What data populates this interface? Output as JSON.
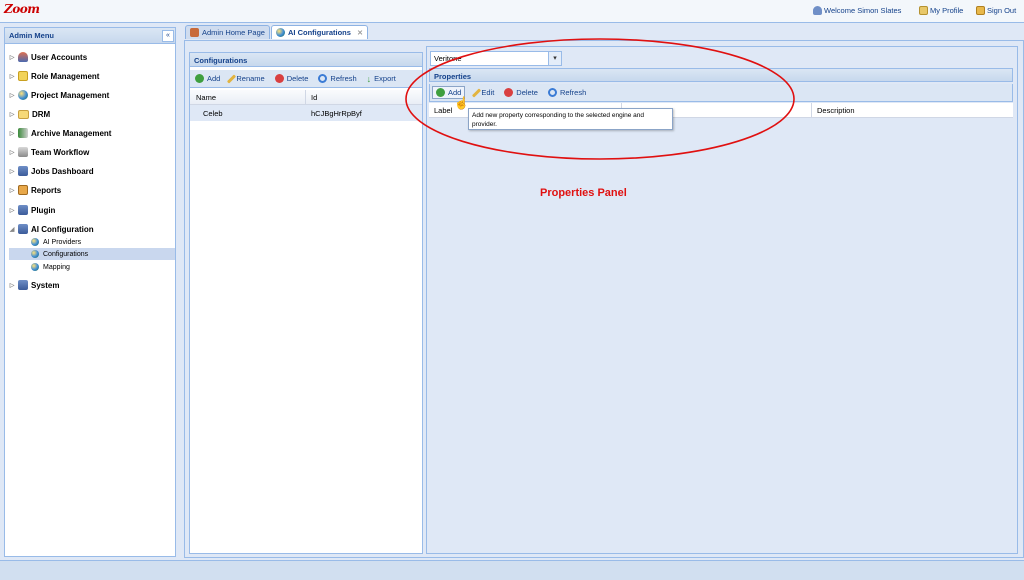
{
  "app": {
    "logo": "Zoom"
  },
  "topbar": {
    "welcome": "Welcome Simon Slates",
    "profile": "My Profile",
    "signout": "Sign Out"
  },
  "sidebar": {
    "title": "Admin Menu",
    "collapse": "«",
    "items": [
      {
        "label": "User Accounts",
        "icon": "user-icon"
      },
      {
        "label": "Role Management",
        "icon": "shield-icon"
      },
      {
        "label": "Project Management",
        "icon": "globe-icon"
      },
      {
        "label": "DRM",
        "icon": "folder-icon"
      },
      {
        "label": "Archive Management",
        "icon": "archive-icon"
      },
      {
        "label": "Team Workflow",
        "icon": "workflow-icon"
      },
      {
        "label": "Jobs Dashboard",
        "icon": "dashboard-icon"
      },
      {
        "label": "Reports",
        "icon": "reports-icon"
      },
      {
        "label": "Plugin",
        "icon": "plugin-icon"
      },
      {
        "label": "AI Configuration",
        "icon": "ai-icon",
        "children": [
          {
            "label": "AI Providers"
          },
          {
            "label": "Configurations",
            "selected": true
          },
          {
            "label": "Mapping"
          }
        ]
      },
      {
        "label": "System",
        "icon": "system-icon"
      }
    ]
  },
  "tabs": [
    {
      "label": "Admin Home Page"
    },
    {
      "label": "AI Configurations",
      "active": true
    }
  ],
  "configurations": {
    "title": "Configurations",
    "toolbar": [
      "Add",
      "Rename",
      "Delete",
      "Refresh",
      "Export"
    ],
    "columns": [
      "Name",
      "Id"
    ],
    "rows": [
      {
        "name": "Celeb",
        "id": "hCJBgHrRpByf"
      }
    ]
  },
  "engine_select": {
    "value": "Veritone"
  },
  "properties": {
    "title": "Properties",
    "toolbar": [
      "Add",
      "Edit",
      "Delete",
      "Refresh"
    ],
    "columns": [
      "Label",
      "Description"
    ],
    "tooltip": "Add new property corresponding to the selected engine and provider."
  },
  "annotation": {
    "label": "Properties Panel",
    "color": "#e01010"
  },
  "colors": {
    "accent": "#15428b",
    "border": "#99bbe8",
    "panel_bg": "#dfe8f6"
  }
}
